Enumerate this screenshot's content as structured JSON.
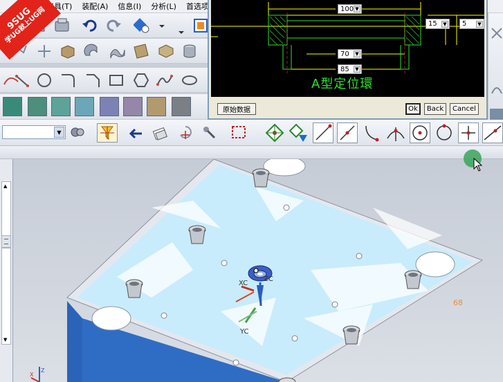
{
  "menubar": {
    "items": [
      "工具(T)",
      "装配(A)",
      "信息(I)",
      "分析(L)",
      "首选项(P)"
    ]
  },
  "watermark": {
    "line1": "9SUG",
    "line2": "学UG就上UG网"
  },
  "dialog": {
    "title": "A型定位環",
    "dims": {
      "top": "100",
      "mid": "70",
      "bottom": "85",
      "right_a": "15",
      "right_b": "5"
    },
    "buttons": {
      "original": "原始数据",
      "ok": "Ok",
      "back": "Back",
      "cancel": "Cancel"
    }
  },
  "viewport": {
    "axis_xc": "XC",
    "axis_yc": "YC",
    "axis_zc": "ZC",
    "dim_label": "68",
    "triad_x": "X",
    "triad_z": "Z"
  },
  "colors": {
    "plate_top": "#e6eaf0",
    "plate_water": "#c8ecfb",
    "plate_base": "#2a64b8",
    "dialog_line": "#ffff00",
    "dialog_green": "#2fe02f",
    "accent_red": "#e2231a"
  },
  "icons": [
    "undo-icon",
    "redo-icon",
    "snap-endpoint-icon",
    "snap-midpoint-icon",
    "snap-center-icon",
    "snap-quadrant-icon",
    "snap-intersection-icon",
    "select-filter-icon"
  ]
}
